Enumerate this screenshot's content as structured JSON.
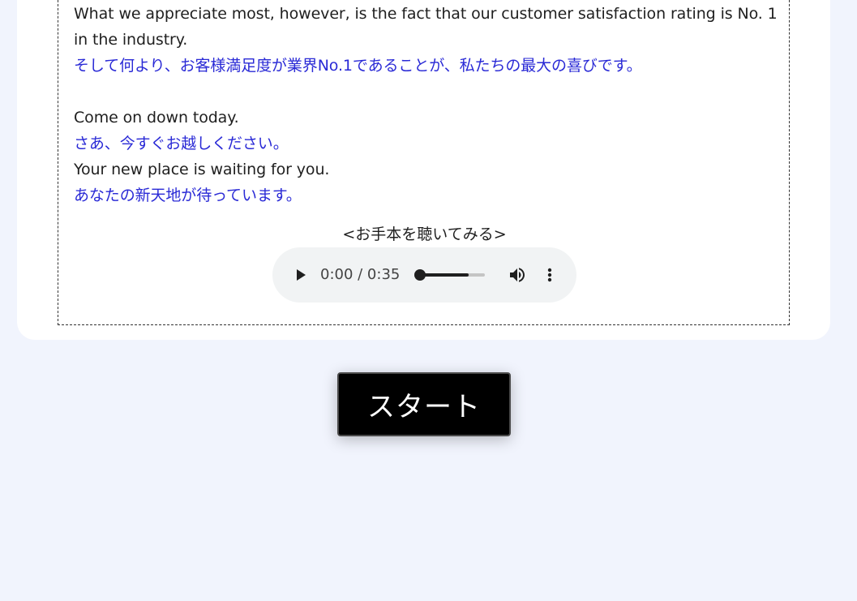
{
  "lesson": {
    "lines": [
      {
        "lang": "en",
        "text": "What we appreciate most, however, is the fact that our customer satisfaction rating is No. 1 in the industry."
      },
      {
        "lang": "ja",
        "text": "そして何より、お客様満足度が業界No.1であることが、私たちの最大の喜びです。"
      },
      {
        "lang": "blank",
        "text": ""
      },
      {
        "lang": "en",
        "text": "Come on down today."
      },
      {
        "lang": "ja",
        "text": "さあ、今すぐお越しください。"
      },
      {
        "lang": "en",
        "text": "Your new place is waiting for you."
      },
      {
        "lang": "ja",
        "text": "あなたの新天地が待っています。"
      }
    ],
    "sample_label": "<お手本を聴いてみる>"
  },
  "audio_player": {
    "time_readout": "0:00 / 0:35",
    "buffered_fraction": 0.76,
    "played_fraction": 0.0,
    "icons": {
      "play": "play-icon",
      "volume": "volume-icon",
      "menu": "more-vert-icon"
    }
  },
  "start_button": {
    "label": "スタート"
  },
  "colors": {
    "background": "#f1f4fd",
    "card": "#ffffff",
    "english_text": "#1f1f1f",
    "japanese_text": "#2a2ad6",
    "button_bg": "#000000",
    "button_text": "#ffffff"
  }
}
